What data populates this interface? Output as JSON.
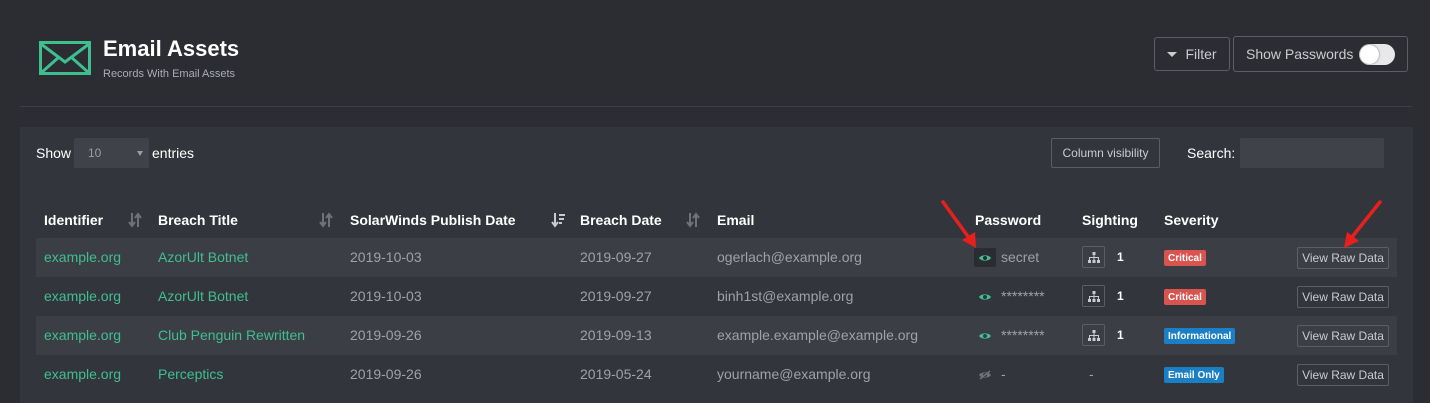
{
  "header": {
    "title": "Email Assets",
    "subtitle": "Records With Email Assets",
    "filter_label": "Filter",
    "show_passwords_label": "Show Passwords",
    "show_passwords_on": false
  },
  "controls": {
    "show_label": "Show",
    "page_length": "10",
    "entries_label": "entries",
    "column_visibility_label": "Column visibility",
    "search_label": "Search:",
    "search_value": ""
  },
  "table": {
    "columns": [
      "Identifier",
      "Breach Title",
      "SolarWinds Publish Date",
      "Breach Date",
      "Email",
      "Password",
      "Sighting",
      "Severity"
    ],
    "rows": [
      {
        "identifier": "example.org",
        "breach_title": "AzorUlt Botnet",
        "publish_date": "2019-10-03",
        "breach_date": "2019-09-27",
        "email": "ogerlach@example.org",
        "password": "secret",
        "sighting": "1",
        "severity": "Critical",
        "action": "View Raw Data"
      },
      {
        "identifier": "example.org",
        "breach_title": "AzorUlt Botnet",
        "publish_date": "2019-10-03",
        "breach_date": "2019-09-27",
        "email": "binh1st@example.org",
        "password": "********",
        "sighting": "1",
        "severity": "Critical",
        "action": "View Raw Data"
      },
      {
        "identifier": "example.org",
        "breach_title": "Club Penguin Rewritten",
        "publish_date": "2019-09-26",
        "breach_date": "2019-09-13",
        "email": "example.example@example.org",
        "password": "********",
        "sighting": "1",
        "severity": "Informational",
        "action": "View Raw Data"
      },
      {
        "identifier": "example.org",
        "breach_title": "Perceptics",
        "publish_date": "2019-09-26",
        "breach_date": "2019-05-24",
        "email": "yourname@example.org",
        "password": "-",
        "sighting": "-",
        "severity": "Email Only",
        "action": "View Raw Data"
      }
    ]
  },
  "colors": {
    "accent_green": "#3fbf8f",
    "critical": "#d9534f",
    "informational": "#1a7fc4",
    "annotation_arrow": "#e8201c"
  },
  "icons": {
    "header": "envelope-icon",
    "password_visible": "eye-icon",
    "password_hidden": "eye-slash-icon",
    "sighting": "sitemap-icon",
    "sort": "sort-icon"
  }
}
